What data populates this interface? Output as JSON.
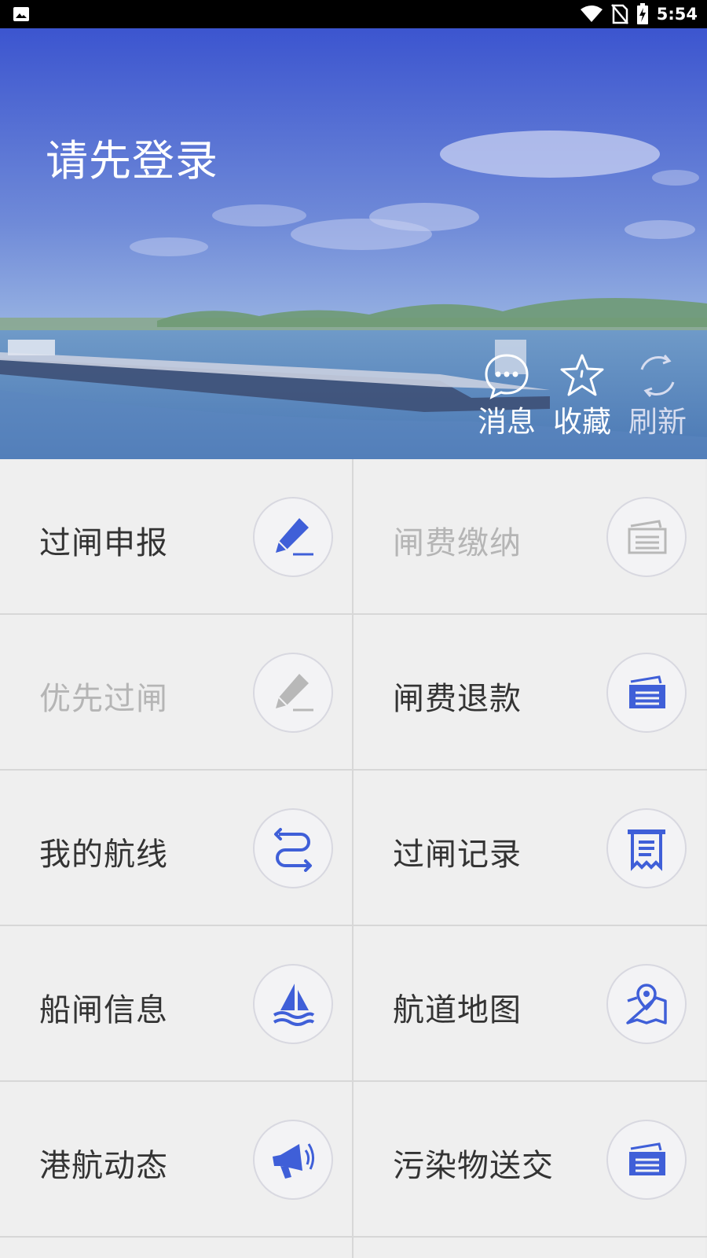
{
  "status_bar": {
    "time": "5:54",
    "icons": [
      "image-icon",
      "wifi-icon",
      "no-sim-icon",
      "battery-charging-icon"
    ]
  },
  "banner": {
    "title": "请先登录",
    "actions": [
      {
        "label": "消息",
        "icon": "message-icon"
      },
      {
        "label": "收藏",
        "icon": "star-icon"
      },
      {
        "label": "刷新",
        "icon": "refresh-icon"
      }
    ]
  },
  "menu": {
    "items": [
      {
        "label": "过闸申报",
        "icon": "pencil-edit-icon",
        "enabled": true
      },
      {
        "label": "闸费缴纳",
        "icon": "ticket-icon",
        "enabled": false
      },
      {
        "label": "优先过闸",
        "icon": "pencil-edit-icon",
        "enabled": false
      },
      {
        "label": "闸费退款",
        "icon": "ticket-icon",
        "enabled": true
      },
      {
        "label": "我的航线",
        "icon": "route-icon",
        "enabled": true
      },
      {
        "label": "过闸记录",
        "icon": "receipt-icon",
        "enabled": true
      },
      {
        "label": "船闸信息",
        "icon": "sailboat-icon",
        "enabled": true
      },
      {
        "label": "航道地图",
        "icon": "map-pin-icon",
        "enabled": true
      },
      {
        "label": "港航动态",
        "icon": "megaphone-icon",
        "enabled": true
      },
      {
        "label": "污染物送交",
        "icon": "ticket-icon",
        "enabled": true
      }
    ]
  },
  "colors": {
    "icon_blue": "#3f5fd8",
    "icon_disabled": "#b8b8b8",
    "text_enabled": "#333333",
    "text_disabled": "#b5b5b5"
  }
}
